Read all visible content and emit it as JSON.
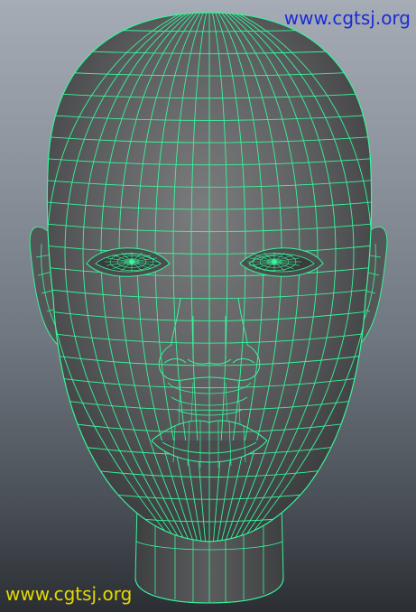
{
  "viewport": {
    "background": "#8e959f",
    "object": "head-mesh",
    "shading": "smooth-shaded-with-wireframe",
    "surface_color": "#5e5f61",
    "wireframe_color": "#37f59b"
  },
  "watermarks": {
    "top_right": "www.cgtsj.org",
    "bottom_left": "www.cgtsj.org",
    "top_right_color": "#1a2bd6",
    "bottom_left_color": "#e5d800"
  }
}
